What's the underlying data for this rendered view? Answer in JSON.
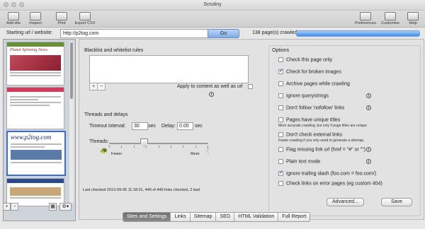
{
  "window": {
    "title": "Scrutiny"
  },
  "toolbar": {
    "left": [
      {
        "label": "Add site",
        "icon": "add-site-icon"
      },
      {
        "label": "Inspect",
        "icon": "inspect-icon"
      },
      {
        "label": "Print",
        "icon": "print-icon"
      },
      {
        "label": "Export CSV",
        "icon": "export-csv-icon"
      }
    ],
    "right": [
      {
        "label": "Preferences",
        "icon": "preferences-icon"
      },
      {
        "label": "Customise",
        "icon": "customise-icon"
      },
      {
        "label": "Help",
        "icon": "help-icon"
      }
    ]
  },
  "crawl": {
    "url_label": "Starting url / website:",
    "url_value": "http://p2tog.com",
    "go_label": "Go",
    "status": "138 page(s) crawled",
    "progress": 1.0
  },
  "sidebar": {
    "thumbs": [
      {
        "title": "Planet Spinning News"
      },
      {
        "title": ""
      },
      {
        "title": "www.p2tog.com"
      },
      {
        "title": ""
      }
    ],
    "add_label": "+",
    "remove_label": "−",
    "grid_label": "▦",
    "gear_label": "⚙▾"
  },
  "rules": {
    "title": "Blacklist and whitelist rules",
    "add_label": "+",
    "remove_label": "−",
    "apply_label": "Apply to content as well as url"
  },
  "threads": {
    "title": "Threads and delays",
    "timeout_label": "Timeout interval:",
    "timeout_value": "30",
    "timeout_unit": "sec",
    "delay_label": "Delay:",
    "delay_value": "0.00",
    "delay_unit": "sec",
    "threads_label": "Threads:",
    "fewer_label": "Fewer",
    "more_label": "More",
    "slider_level": 0.33
  },
  "last_checked": "Last checked 2013-09-05 11:18:31, 449 of 449 links checked, 2 bad",
  "options": {
    "title": "Options",
    "items": [
      {
        "label": "Check this page only",
        "checked": false,
        "info": false,
        "sub": ""
      },
      {
        "label": "Check for broken images",
        "checked": true,
        "info": false,
        "sub": ""
      },
      {
        "label": "Archive pages while crawling",
        "checked": false,
        "info": false,
        "sub": ""
      },
      {
        "label": "Ignore querystrings",
        "checked": false,
        "info": true,
        "sub": ""
      },
      {
        "label": "Don't follow 'nofollow' links",
        "checked": false,
        "info": true,
        "sub": ""
      },
      {
        "label": "Pages have unique titles",
        "checked": false,
        "info": false,
        "sub": "More accurate crawling, but only if page titles are unique"
      },
      {
        "label": "Don't check external links",
        "checked": false,
        "info": false,
        "sub": "Faster crawling if you only need to generate a sitemap."
      },
      {
        "label": "Flag missing link url (href = \"#\"  or  \"\")",
        "checked": false,
        "info": true,
        "sub": ""
      },
      {
        "label": "Plain text mode",
        "checked": false,
        "info": true,
        "sub": ""
      },
      {
        "label": "Ignore trailing slash (foo.com = foo.com/)",
        "checked": true,
        "info": false,
        "sub": ""
      },
      {
        "label": "Check links on error pages (eg custom 404)",
        "checked": false,
        "info": false,
        "sub": ""
      }
    ],
    "advanced_label": "Advanced...",
    "save_label": "Save"
  },
  "tabs": [
    "Sites and Settings",
    "Links",
    "Sitemap",
    "SEO",
    "HTML Validation",
    "Full Report"
  ],
  "active_tab": 0
}
